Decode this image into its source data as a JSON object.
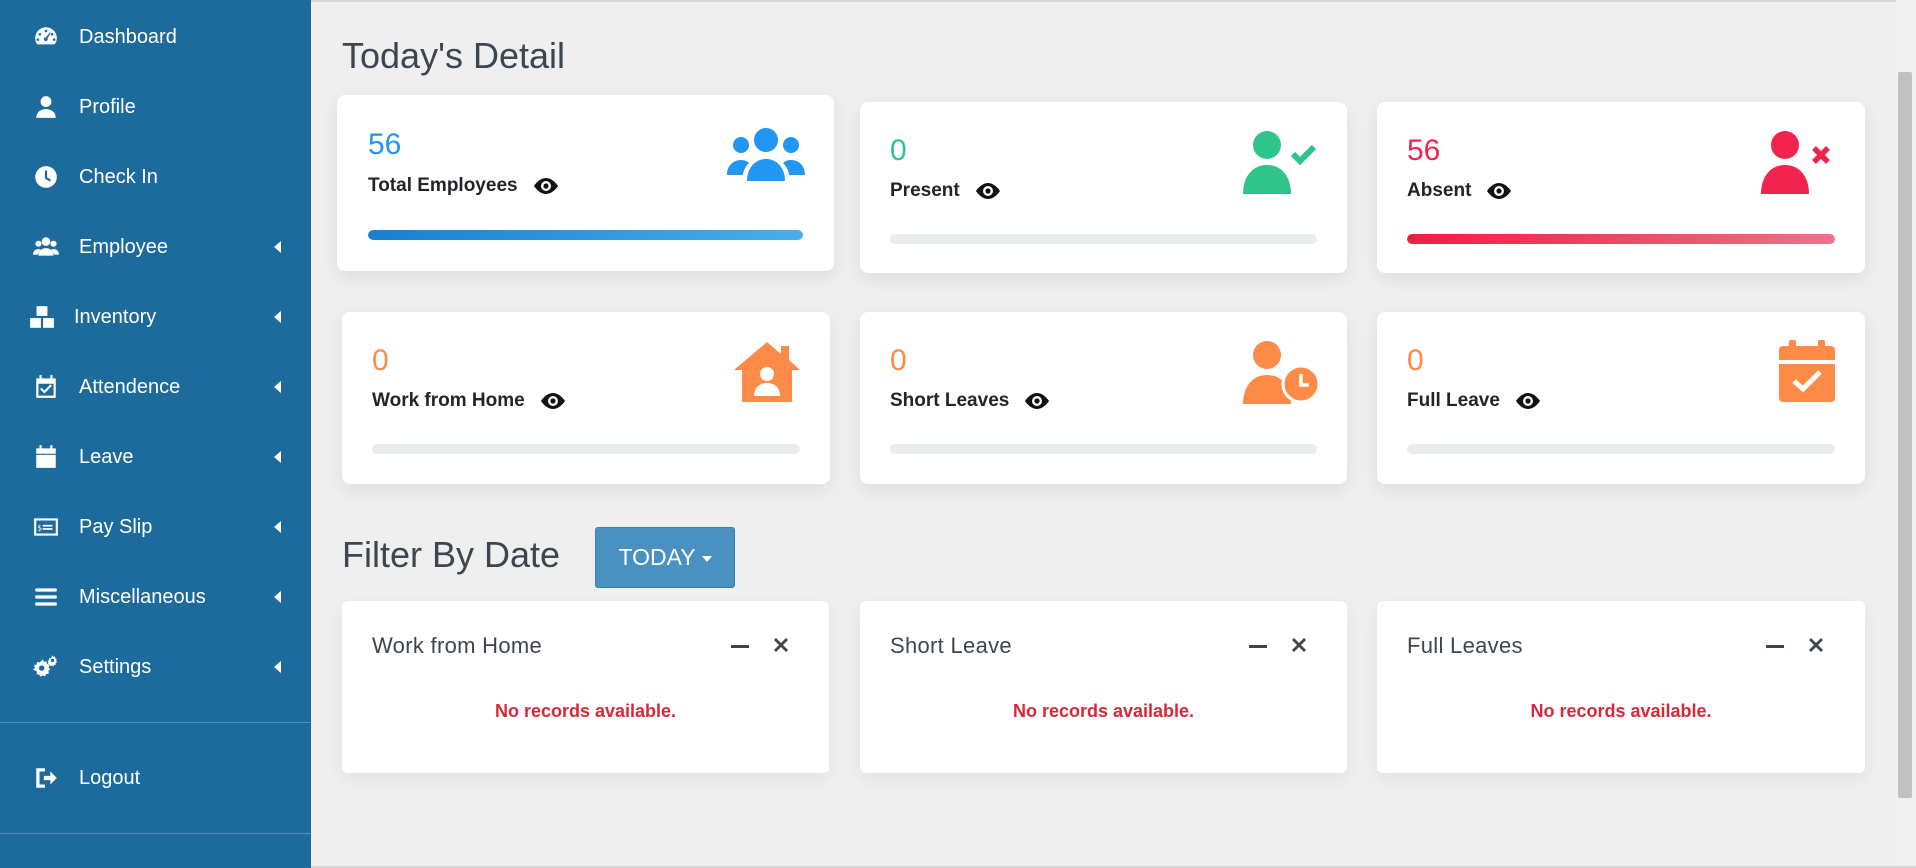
{
  "sidebar": {
    "items": [
      {
        "label": "Dashboard",
        "icon": "dashboard-icon"
      },
      {
        "label": "Profile",
        "icon": "user-icon"
      },
      {
        "label": "Check In",
        "icon": "clock-icon"
      },
      {
        "label": "Employee",
        "icon": "users-icon"
      },
      {
        "label": "Inventory",
        "icon": "boxes-icon"
      },
      {
        "label": "Attendence",
        "icon": "calendar-check-icon"
      },
      {
        "label": "Leave",
        "icon": "calendar-icon"
      },
      {
        "label": "Pay Slip",
        "icon": "money-check-icon"
      },
      {
        "label": "Miscellaneous",
        "icon": "bars-icon"
      },
      {
        "label": "Settings",
        "icon": "gears-icon"
      }
    ],
    "logout": {
      "label": "Logout",
      "icon": "sign-out-icon"
    }
  },
  "main": {
    "title": "Today's Detail",
    "stats": [
      {
        "count": "56",
        "label": "Total Employees",
        "color": "#2196f3",
        "fill": 1.0,
        "icon": "users-icon"
      },
      {
        "count": "0",
        "label": "Present",
        "color": "#2ec48a",
        "fill": 0,
        "icon": "user-check-icon"
      },
      {
        "count": "56",
        "label": "Absent",
        "color": "#f0244f",
        "fill": 1.0,
        "icon": "user-times-icon"
      },
      {
        "count": "0",
        "label": "Work from Home",
        "color": "#fd8a47",
        "fill": 0,
        "icon": "house-user-icon"
      },
      {
        "count": "0",
        "label": "Short Leaves",
        "color": "#fd8a47",
        "fill": 0,
        "icon": "user-clock-icon"
      },
      {
        "count": "0",
        "label": "Full Leave",
        "color": "#fd8a47",
        "fill": 0,
        "icon": "calendar-check-icon"
      }
    ],
    "filter": {
      "title": "Filter By Date",
      "button": "TODAY"
    },
    "panels": [
      {
        "title": "Work from Home",
        "empty": "No records available."
      },
      {
        "title": "Short Leave",
        "empty": "No records available."
      },
      {
        "title": "Full Leaves",
        "empty": "No records available."
      }
    ]
  }
}
